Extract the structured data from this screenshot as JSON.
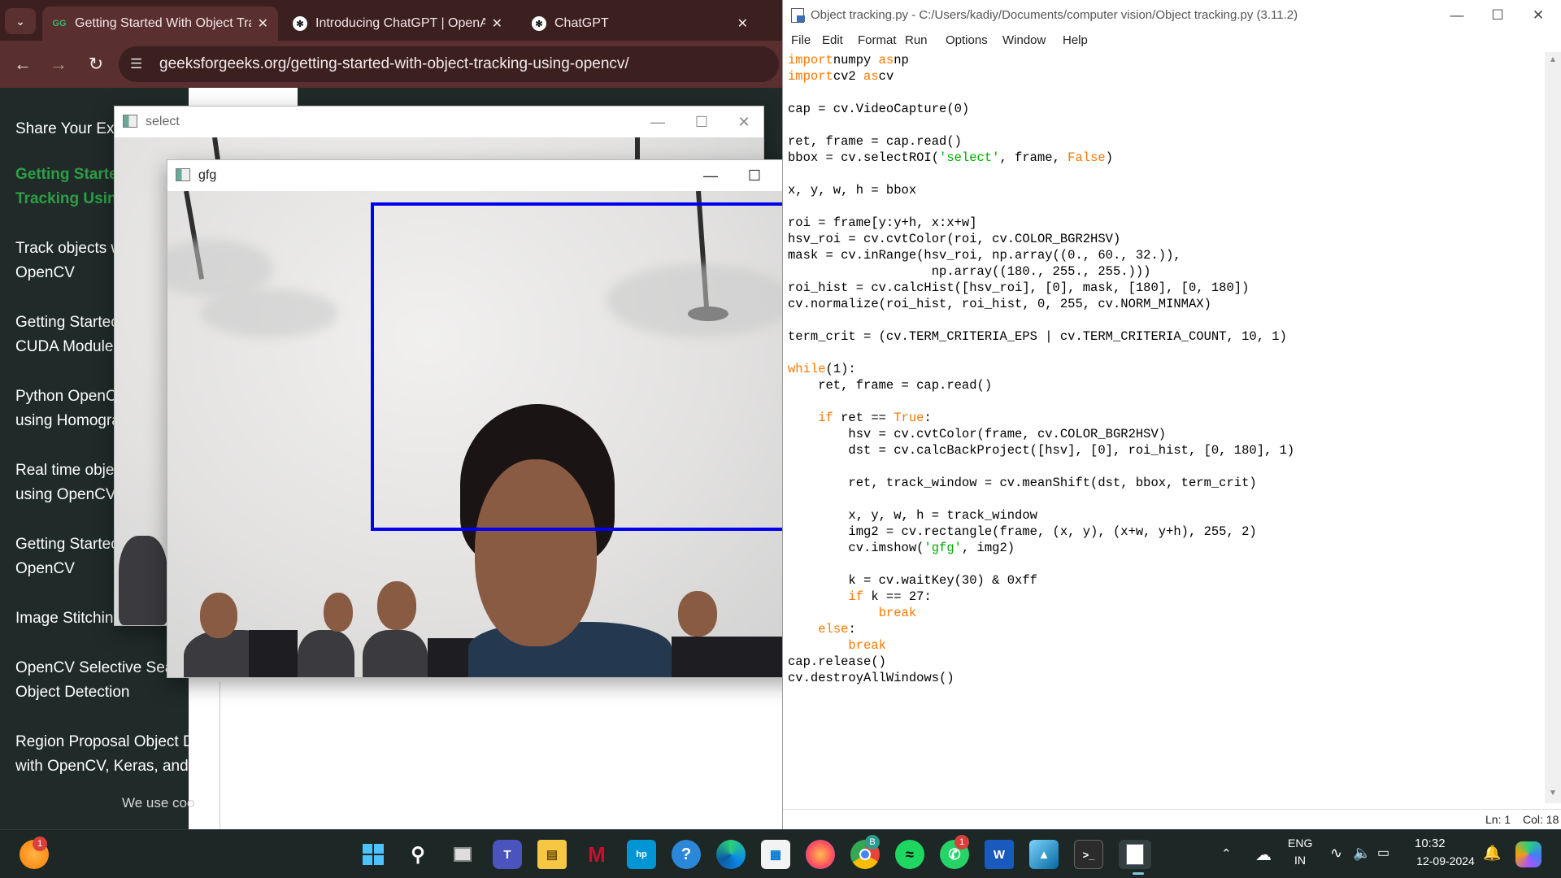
{
  "browser": {
    "tabs": [
      {
        "title": "Getting Started With Object Tra",
        "active": true
      },
      {
        "title": "Introducing ChatGPT | OpenAI",
        "active": false
      },
      {
        "title": "ChatGPT",
        "active": false
      }
    ],
    "url": "geeksforgeeks.org/getting-started-with-object-tracking-using-opencv/",
    "sidebar": {
      "header": "Share Your Exp",
      "items": [
        {
          "line1": "Getting Starte",
          "line2": "Tracking Using",
          "current": true
        },
        {
          "line1": "Track objects w",
          "line2": "OpenCV"
        },
        {
          "line1": "Getting Startec",
          "line2": "CUDA Module"
        },
        {
          "line1": "Python OpenC",
          "line2": "using Homogra"
        },
        {
          "line1": "Real time obje",
          "line2": "using OpenCV"
        },
        {
          "line1": "Getting Startec",
          "line2": "OpenCV"
        },
        {
          "line1": "Image Stitching",
          "line2": ""
        },
        {
          "line1": "OpenCV Selective Sear",
          "line2": "Object Detection"
        },
        {
          "line1": "Region Proposal Object D",
          "line2": "with OpenCV, Keras, and"
        }
      ],
      "cookie": "We use coo"
    }
  },
  "windows": {
    "select": {
      "title": "select"
    },
    "gfg": {
      "title": "gfg"
    }
  },
  "idle": {
    "title": "Object tracking.py - C:/Users/kadiy/Documents/computer vision/Object tracking.py (3.11.2)",
    "menu": [
      "File",
      "Edit",
      "Format",
      "Run",
      "Options",
      "Window",
      "Help"
    ],
    "status": {
      "line": "Ln: 1",
      "col": "Col: 18"
    }
  },
  "code": [
    [
      [
        "kw",
        "import"
      ],
      [
        "",
        "numpy "
      ],
      [
        "kw",
        "as"
      ],
      [
        "",
        "np"
      ]
    ],
    [
      [
        "kw",
        "import"
      ],
      [
        "",
        "cv2 "
      ],
      [
        "kw",
        "as"
      ],
      [
        "",
        "cv"
      ]
    ],
    [
      [
        "",
        ""
      ]
    ],
    [
      [
        "",
        "cap = cv.VideoCapture(0)"
      ]
    ],
    [
      [
        "",
        ""
      ]
    ],
    [
      [
        "",
        "ret, frame = cap.read()"
      ]
    ],
    [
      [
        "",
        "bbox = cv.selectROI("
      ],
      [
        "str",
        "'select'"
      ],
      [
        "",
        ", frame, "
      ],
      [
        "kw",
        "False"
      ],
      [
        "",
        ")"
      ]
    ],
    [
      [
        "",
        ""
      ]
    ],
    [
      [
        "",
        "x, y, w, h = bbox"
      ]
    ],
    [
      [
        "",
        ""
      ]
    ],
    [
      [
        "",
        "roi = frame[y:y+h, x:x+w]"
      ]
    ],
    [
      [
        "",
        "hsv_roi = cv.cvtColor(roi, cv.COLOR_BGR2HSV)"
      ]
    ],
    [
      [
        "",
        "mask = cv.inRange(hsv_roi, np.array((0., 60., 32.)),"
      ]
    ],
    [
      [
        "",
        "                   np.array((180., 255., 255.)))"
      ]
    ],
    [
      [
        "",
        "roi_hist = cv.calcHist([hsv_roi], [0], mask, [180], [0, 180])"
      ]
    ],
    [
      [
        "",
        "cv.normalize(roi_hist, roi_hist, 0, 255, cv.NORM_MINMAX)"
      ]
    ],
    [
      [
        "",
        ""
      ]
    ],
    [
      [
        "",
        "term_crit = (cv.TERM_CRITERIA_EPS | cv.TERM_CRITERIA_COUNT, 10, 1)"
      ]
    ],
    [
      [
        "",
        ""
      ]
    ],
    [
      [
        "kw",
        "while"
      ],
      [
        "",
        "(1):"
      ]
    ],
    [
      [
        "",
        "    ret, frame = cap.read()"
      ]
    ],
    [
      [
        "",
        ""
      ]
    ],
    [
      [
        "",
        "    "
      ],
      [
        "kw",
        "if"
      ],
      [
        "",
        " ret == "
      ],
      [
        "kw",
        "True"
      ],
      [
        "",
        ":"
      ]
    ],
    [
      [
        "",
        "        hsv = cv.cvtColor(frame, cv.COLOR_BGR2HSV)"
      ]
    ],
    [
      [
        "",
        "        dst = cv.calcBackProject([hsv], [0], roi_hist, [0, 180], 1)"
      ]
    ],
    [
      [
        "",
        ""
      ]
    ],
    [
      [
        "",
        "        ret, track_window = cv.meanShift(dst, bbox, term_crit)"
      ]
    ],
    [
      [
        "",
        ""
      ]
    ],
    [
      [
        "",
        "        x, y, w, h = track_window"
      ]
    ],
    [
      [
        "",
        "        img2 = cv.rectangle(frame, (x, y), (x+w, y+h), 255, 2)"
      ]
    ],
    [
      [
        "",
        "        cv.imshow("
      ],
      [
        "str",
        "'gfg'"
      ],
      [
        "",
        ", img2)"
      ]
    ],
    [
      [
        "",
        ""
      ]
    ],
    [
      [
        "",
        "        k = cv.waitKey(30) & 0xff"
      ]
    ],
    [
      [
        "",
        "        "
      ],
      [
        "kw",
        "if"
      ],
      [
        "",
        " k == 27:"
      ]
    ],
    [
      [
        "",
        "            "
      ],
      [
        "kw",
        "break"
      ]
    ],
    [
      [
        "",
        "    "
      ],
      [
        "kw",
        "else"
      ],
      [
        "",
        ":"
      ]
    ],
    [
      [
        "",
        "        "
      ],
      [
        "kw",
        "break"
      ]
    ],
    [
      [
        "",
        "cap.release()"
      ]
    ],
    [
      [
        "",
        "cv.destroyAllWindows()"
      ]
    ]
  ],
  "taskbar": {
    "apps": [
      "Start",
      "Search",
      "Task View",
      "Teams",
      "File Explorer",
      "McAfee",
      "myhp",
      "Get Help",
      "Edge",
      "Microsoft Store",
      "Firefox",
      "Chrome",
      "Spotify",
      "WhatsApp",
      "Word",
      "Photos",
      "Terminal",
      "IDLE"
    ],
    "lang": "ENG",
    "region": "IN",
    "time": "10:32",
    "date": "12-09-2024",
    "badges": {
      "widget": "1",
      "whatsapp": "1",
      "chrome": "B"
    }
  }
}
